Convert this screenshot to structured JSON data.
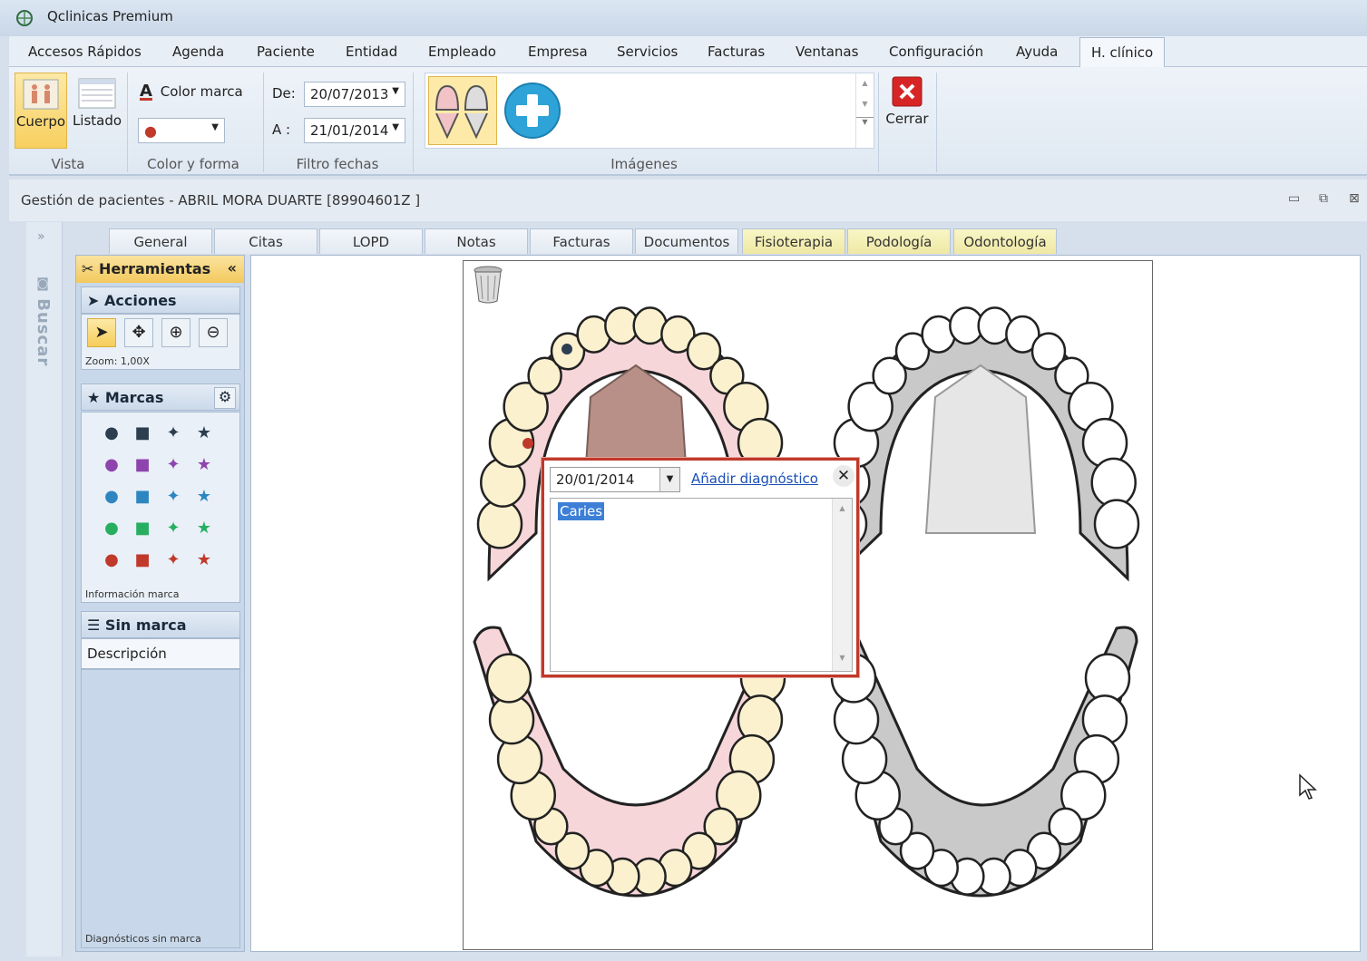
{
  "window": {
    "title": "Qclinicas Premium"
  },
  "menu": [
    "Accesos Rápidos",
    "Agenda",
    "Paciente",
    "Entidad",
    "Empleado",
    "Empresa",
    "Servicios",
    "Facturas",
    "Ventanas",
    "Configuración",
    "Ayuda",
    "H. clínico"
  ],
  "ribbon": {
    "cuerpo": "Cuerpo",
    "listado": "Listado",
    "vista": "Vista",
    "color_marca": "Color marca",
    "color_forma": "Color y forma",
    "de_label": "De:",
    "de_value": "20/07/2013",
    "a_label": "A :",
    "a_value": "21/01/2014",
    "filtro_fechas": "Filtro fechas",
    "imagenes": "Imágenes",
    "cerrar": "Cerrar"
  },
  "document": {
    "title": "Gestión de pacientes - ABRIL MORA DUARTE  [89904601Z ]"
  },
  "search": {
    "label": "Buscar"
  },
  "tabs": [
    "General",
    "Citas",
    "LOPD",
    "Notas",
    "Facturas",
    "Documentos",
    "Fisioterapia",
    "Podología",
    "Odontología"
  ],
  "tools": {
    "header": "Herramientas",
    "acciones": "Acciones",
    "zoom": "Zoom: 1,00X",
    "marcas": "Marcas",
    "info_marca": "Información marca",
    "sin_marca": "Sin marca",
    "descripcion": "Descripción",
    "diag_sin_marca": "Diagnósticos sin marca"
  },
  "mark_colors": [
    "#2c3e50",
    "#8e44ad",
    "#2e86c1",
    "#27ae60",
    "#c0392b"
  ],
  "popup": {
    "date": "20/01/2014",
    "add_link": "Añadir diagnóstico",
    "selected_item": "Caries"
  }
}
